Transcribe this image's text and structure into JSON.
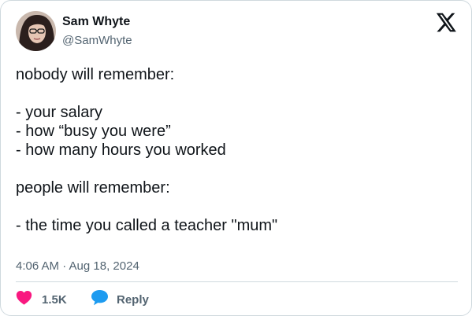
{
  "author": {
    "name": "Sam Whyte",
    "handle": "@SamWhyte"
  },
  "tweet": {
    "lines": [
      "nobody will remember:",
      "",
      "- your salary",
      "- how “busy you were”",
      "- how many hours you worked",
      "",
      "people will remember:",
      "",
      "- the time you called a teacher \"mum\""
    ],
    "timestamp": "4:06 AM · Aug 18, 2024"
  },
  "actions": {
    "like_count": "1.5K",
    "reply_label": "Reply"
  },
  "icons": {
    "platform": "x-logo-icon",
    "like": "heart-icon",
    "reply": "speech-bubble-icon"
  },
  "colors": {
    "like": "#f91880",
    "reply": "#1d9bf0",
    "secondary_text": "#536471",
    "border": "#cfd9de"
  }
}
